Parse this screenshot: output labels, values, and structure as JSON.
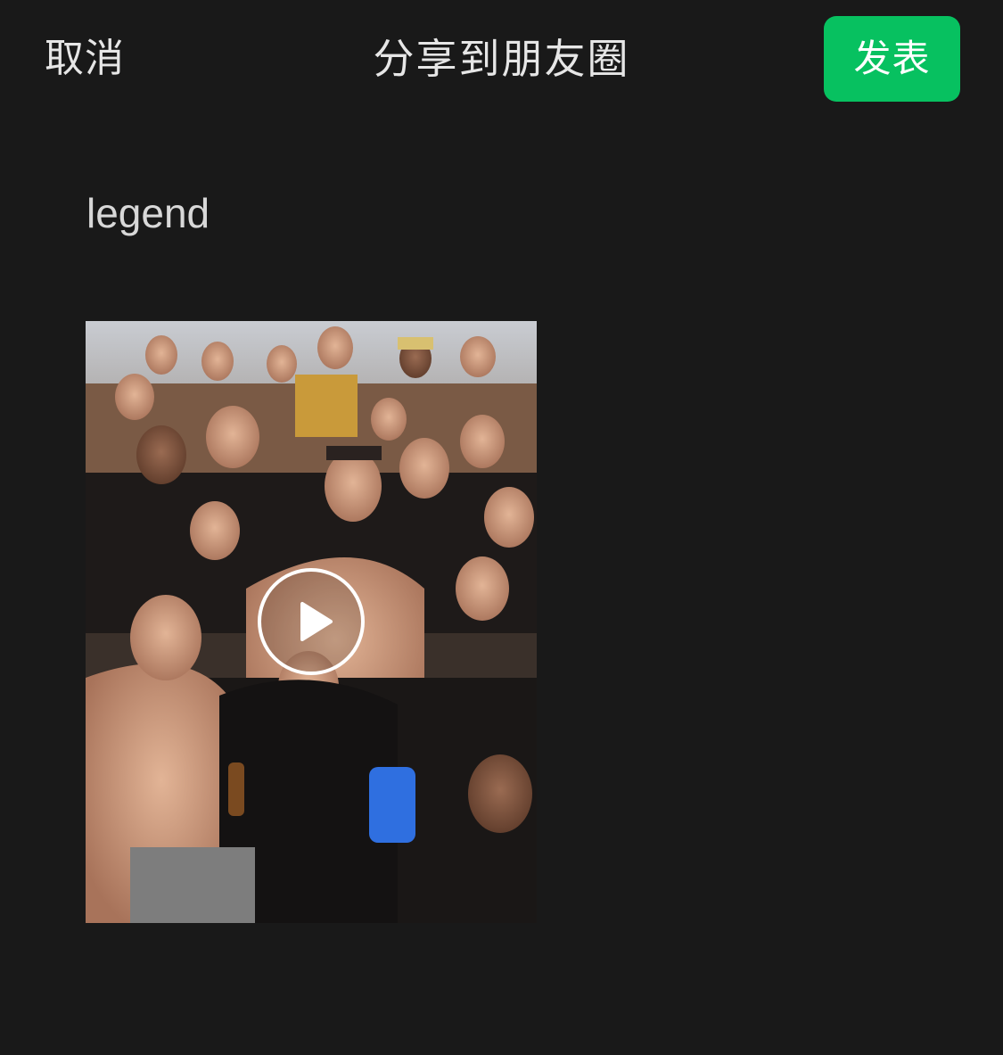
{
  "header": {
    "cancel_label": "取消",
    "title": "分享到朋友圈",
    "publish_label": "发表"
  },
  "post": {
    "caption": "legend"
  },
  "media": {
    "type": "video",
    "play_icon": "play-circle-icon"
  },
  "colors": {
    "background": "#191919",
    "accent": "#07c160",
    "text": "#e6e6e6"
  }
}
